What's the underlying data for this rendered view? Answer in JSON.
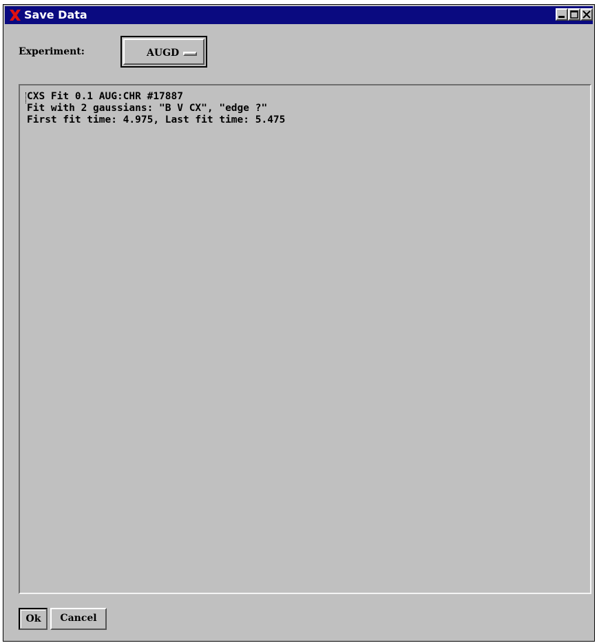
{
  "window": {
    "title": "Save Data",
    "app_icon": "x-logo-icon",
    "title_bar_color": "#0a0a80",
    "controls": [
      "minimize-icon",
      "maximize-icon",
      "close-icon"
    ]
  },
  "form": {
    "experiment_label": "Experiment:",
    "experiment_value": "AUGD"
  },
  "comment_text": {
    "lines": [
      "CXS Fit 0.1 AUG:CHR #17887",
      "Fit with 2 gaussians: \"B V CX\", \"edge ?\"",
      "First fit time: 4.975, Last fit time: 5.475"
    ]
  },
  "buttons": {
    "ok_label": "Ok",
    "cancel_label": "Cancel"
  }
}
